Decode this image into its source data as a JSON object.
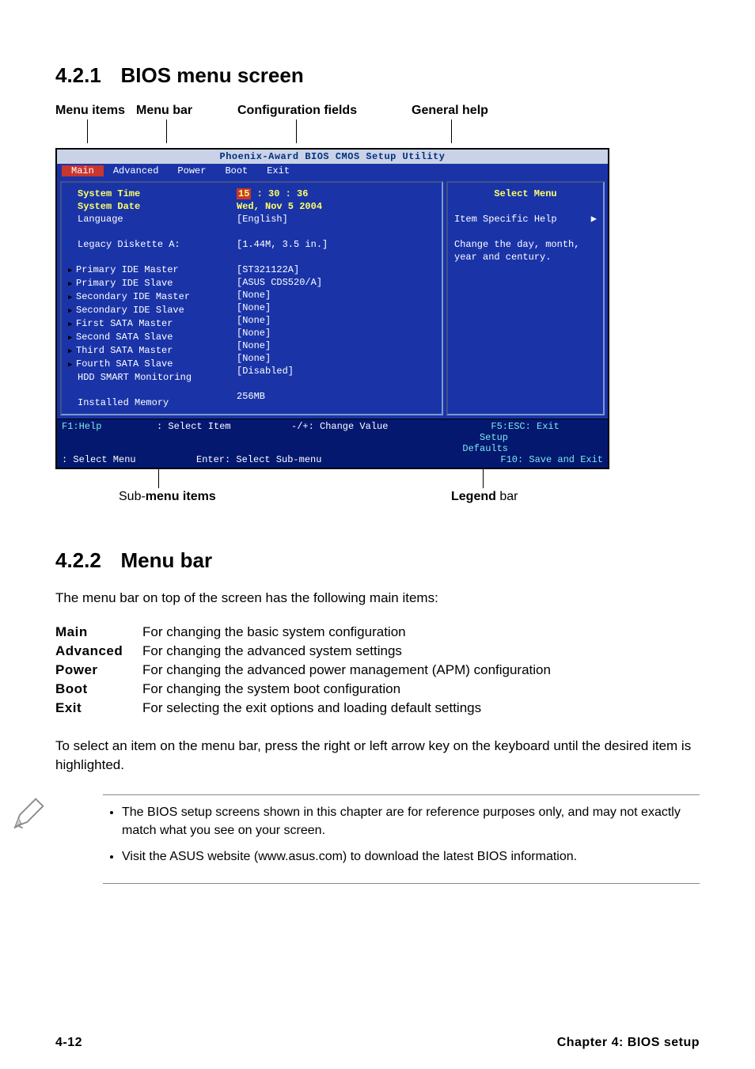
{
  "section1": {
    "num": "4.2.1",
    "title": "BIOS menu screen"
  },
  "section2": {
    "num": "4.2.2",
    "title": "Menu bar"
  },
  "annot": {
    "menu_items": "Menu items",
    "menu_bar": "Menu bar",
    "config_fields": "Configuration fields",
    "general_help": "General help",
    "sub_menu_items_prefix": "Sub-",
    "sub_menu_items": "menu items",
    "legend": "Legend",
    "bar": " bar"
  },
  "bios": {
    "title": "Phoenix-Award BIOS CMOS Setup Utility",
    "tabs": [
      "Main",
      "Advanced",
      "Power",
      "Boot",
      "Exit"
    ],
    "rows": [
      {
        "label": "System Time",
        "yellow": true,
        "value_prefix": "",
        "hour": "15",
        "rest": " : 30 : 36",
        "space_after": false
      },
      {
        "label": "System Date",
        "yellow": true,
        "value": "Wed, Nov 5 2004"
      },
      {
        "label": "Language",
        "value": "  [English]"
      },
      {
        "label": "",
        "value": ""
      },
      {
        "label": "Legacy Diskette A:",
        "value": "  [1.44M, 3.5 in.]"
      },
      {
        "label": "",
        "value": ""
      },
      {
        "label": "Primary IDE Master",
        "arrow": true,
        "value": " [ST321122A]"
      },
      {
        "label": "Primary IDE Slave",
        "arrow": true,
        "value": "  [ASUS CDS520/A]"
      },
      {
        "label": "Secondary IDE Master",
        "arrow": true,
        "value": "[None]"
      },
      {
        "label": "Secondary IDE Slave",
        "arrow": true,
        "value": "[None]"
      },
      {
        "label": "First SATA Master",
        "arrow": true,
        "value": "[None]"
      },
      {
        "label": "Second SATA Slave",
        "arrow": true,
        "value": "[None]"
      },
      {
        "label": "Third SATA Master",
        "arrow": true,
        "value": "[None]"
      },
      {
        "label": "Fourth SATA Slave",
        "arrow": true,
        "value": "[None]"
      },
      {
        "label": "HDD SMART Monitoring",
        "value": " [Disabled]"
      },
      {
        "label": "",
        "value": ""
      },
      {
        "label": "Installed Memory",
        "value": "  256MB"
      }
    ],
    "help_title": "Select Menu",
    "help_sub": "Item Specific Help",
    "help_text": "Change the day, month, year and century.",
    "legend_rows": [
      {
        "l": "F1:Help",
        "m": ": Select Item",
        "r": "-/+:  Change Value",
        "x": "F5: Setup Defaults"
      },
      {
        "l": "ESC: Exit",
        "m": ": Select Menu",
        "r": "Enter: Select Sub-menu",
        "x": "F10: Save and Exit"
      }
    ]
  },
  "menubar_intro": "The menu bar on top of the screen has the following main items:",
  "defs": [
    {
      "k": "Main",
      "v": "For changing the basic system configuration"
    },
    {
      "k": "Advanced",
      "v": "For changing the advanced system settings"
    },
    {
      "k": "Power",
      "v": "For changing the advanced power management (APM) configuration"
    },
    {
      "k": "Boot",
      "v": "For changing the system boot configuration"
    },
    {
      "k": "Exit",
      "v": "For selecting the exit options and loading default settings"
    }
  ],
  "select_para": "To select an item on the menu bar, press the right or left arrow key on the keyboard until the desired item is highlighted.",
  "notes": [
    "The BIOS setup screens shown in this chapter are for reference purposes only, and may not exactly match what you see on your screen.",
    "Visit the ASUS website (www.asus.com) to download the latest BIOS information."
  ],
  "footer": {
    "left": "4-12",
    "right": "Chapter 4: BIOS setup"
  }
}
